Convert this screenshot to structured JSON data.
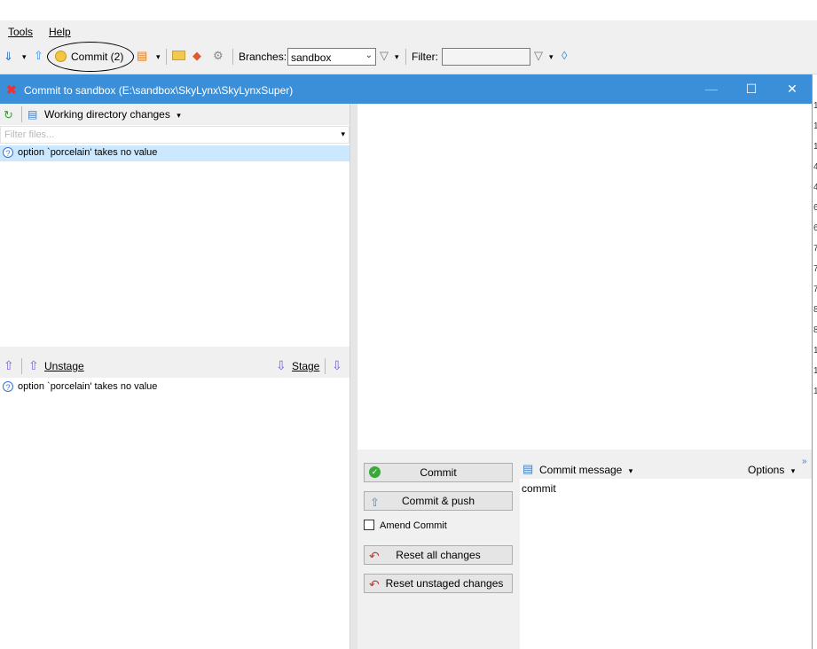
{
  "menu": {
    "tools": "Tools",
    "help": "Help"
  },
  "toolbar": {
    "commit_label": "Commit (2)",
    "branches_label": "Branches:",
    "branch_value": "sandbox",
    "filter_label": "Filter:",
    "filter_value": ""
  },
  "dialog": {
    "title": "Commit to sandbox (E:\\sandbox\\SkyLynx\\SkyLynxSuper)",
    "minimize": "—",
    "maximize": "☐",
    "close": "✕"
  },
  "unstaged": {
    "header": "Working directory changes",
    "filter_placeholder": "Filter files...",
    "files": [
      "option `porcelain' takes no value"
    ]
  },
  "staged": {
    "unstage_label": "Unstage",
    "stage_label": "Stage",
    "files": [
      "option `porcelain' takes no value"
    ]
  },
  "commit": {
    "commit_button": "Commit",
    "commit_push_button": "Commit & push",
    "amend_label": "Amend Commit",
    "amend_checked": false,
    "reset_all_button": "Reset all changes",
    "reset_unstaged_button": "Reset unstaged changes",
    "message_header": "Commit message",
    "options_label": "Options",
    "message_text": "commit"
  },
  "right_strip_digits": [
    "1",
    "1",
    "1",
    "4",
    "4",
    "6",
    "6",
    "7",
    "7",
    "7",
    "8",
    "8",
    "1",
    "1",
    "1"
  ],
  "colors": {
    "titlebar": "#3b8fd8",
    "selected_row": "#cce8ff",
    "accent_purple": "#7b5bd6"
  }
}
